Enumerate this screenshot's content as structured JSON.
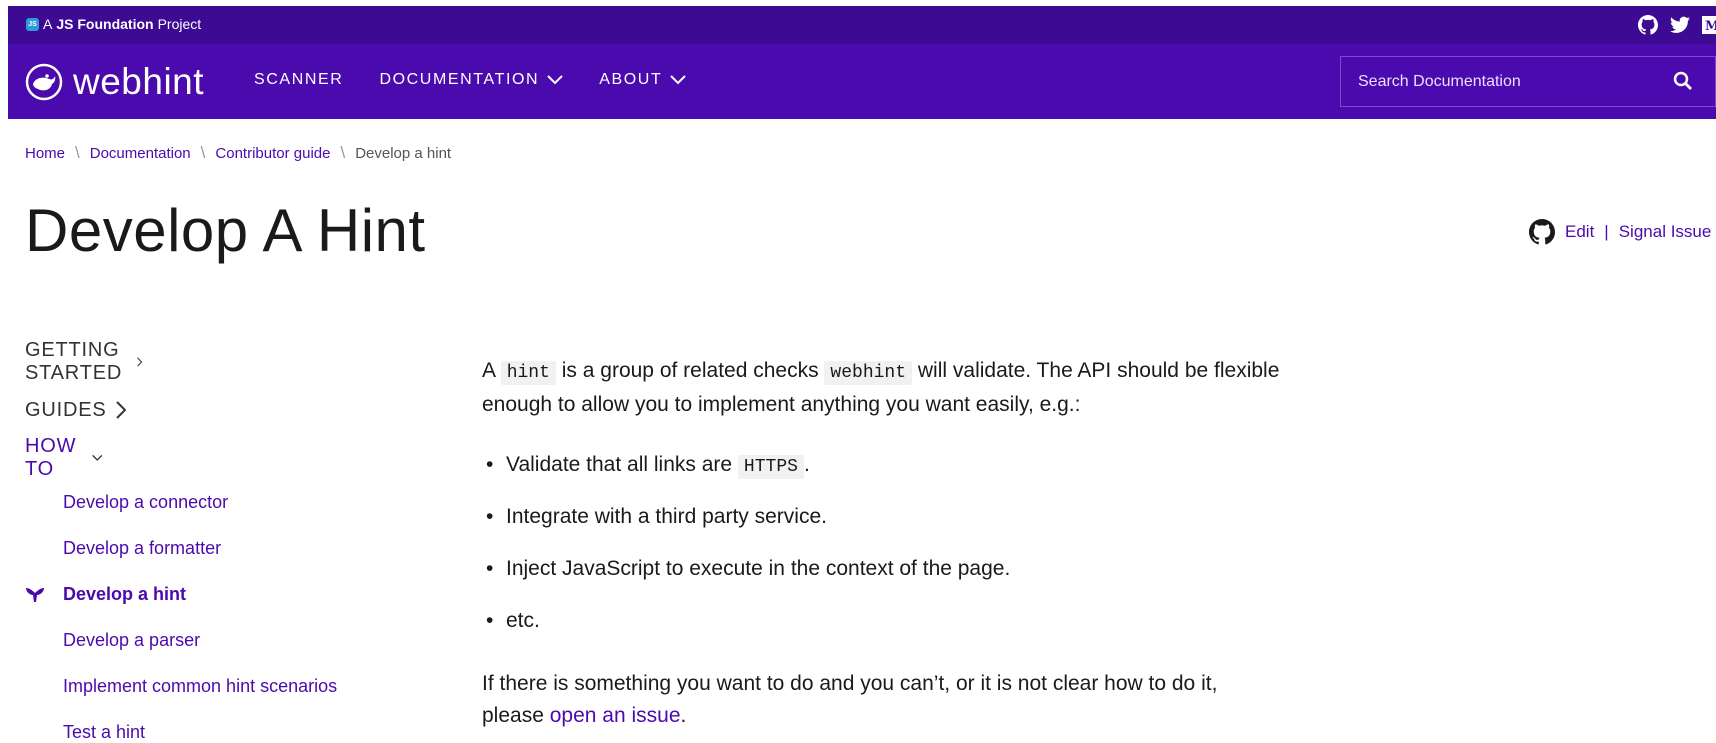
{
  "topbar": {
    "prefix": "A",
    "foundation": "JS Foundation",
    "suffix": "Project",
    "badge": "JS",
    "social_icons": [
      "github-icon",
      "twitter-icon",
      "medium-icon"
    ]
  },
  "nav": {
    "brand": "webhint",
    "links": [
      {
        "label": "SCANNER",
        "has_dropdown": false
      },
      {
        "label": "DOCUMENTATION",
        "has_dropdown": true
      },
      {
        "label": "ABOUT",
        "has_dropdown": true
      }
    ],
    "search": {
      "placeholder": "Search Documentation",
      "value": ""
    }
  },
  "breadcrumb": {
    "items": [
      "Home",
      "Documentation",
      "Contributor guide"
    ],
    "current": "Develop a hint"
  },
  "page": {
    "title": "Develop A Hint",
    "edit_label": "Edit",
    "separator": "|",
    "signal_label": "Signal Issue"
  },
  "sidebar": {
    "sections": [
      {
        "label": "GETTING STARTED",
        "expanded": false
      },
      {
        "label": "GUIDES",
        "expanded": false
      },
      {
        "label": "HOW TO",
        "expanded": true
      }
    ],
    "items": [
      {
        "label": "Develop a connector",
        "active": false
      },
      {
        "label": "Develop a formatter",
        "active": false
      },
      {
        "label": "Develop a hint",
        "active": true
      },
      {
        "label": "Develop a parser",
        "active": false
      },
      {
        "label": "Implement common hint scenarios",
        "active": false
      },
      {
        "label": "Test a hint",
        "active": false
      }
    ]
  },
  "content": {
    "intro": {
      "p1": "A",
      "code1": "hint",
      "p2": "is a group of related checks",
      "code2": "webhint",
      "p3": "will validate. The API should be flexible",
      "p4": "enough to allow you to implement anything you want easily, e.g.:"
    },
    "bullets": {
      "b1_text": "Validate that all links are",
      "b1_code": "HTTPS",
      "b1_end": ".",
      "b2": "Integrate with a third party service.",
      "b3": "Inject JavaScript to execute in the context of the page.",
      "b4": "etc."
    },
    "outro": {
      "line1": "If there is something you want to do and you can’t, or it is not clear how to do it,",
      "line2_prefix": "please",
      "link": "open an issue",
      "line2_suffix": "."
    }
  },
  "colors": {
    "topbar": "#3d0a93",
    "nav": "#4b0aad",
    "accent": "#4b0aad"
  }
}
